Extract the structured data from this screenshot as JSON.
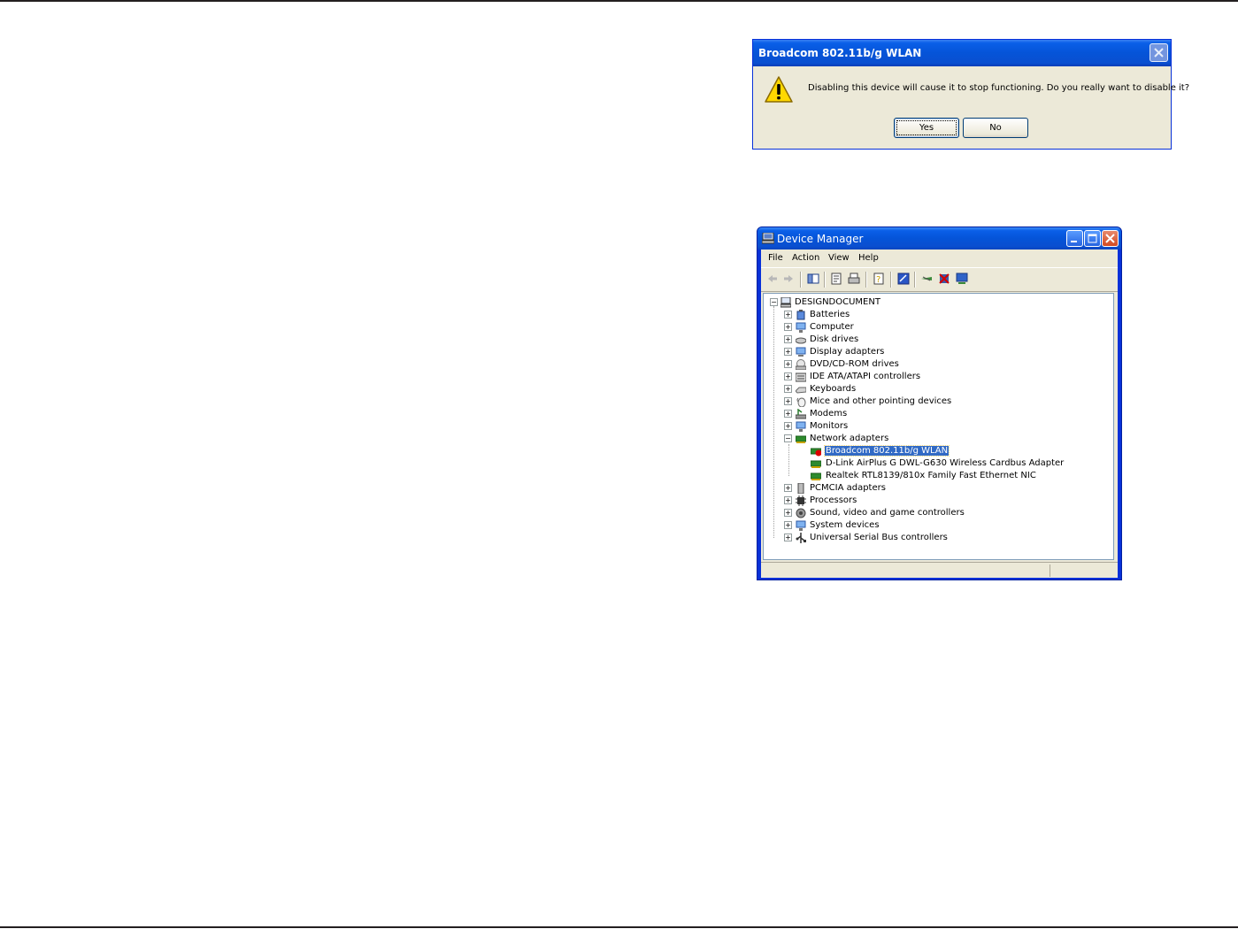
{
  "dialog": {
    "title": "Broadcom 802.11b/g WLAN",
    "message": "Disabling this device will cause it to stop functioning. Do you really want to disable it?",
    "yes_label": "Yes",
    "no_label": "No"
  },
  "device_manager": {
    "title": "Device Manager",
    "menu": [
      "File",
      "Action",
      "View",
      "Help"
    ],
    "tree": {
      "root": "DESIGNDOCUMENT",
      "categories": [
        "Batteries",
        "Computer",
        "Disk drives",
        "Display adapters",
        "DVD/CD-ROM drives",
        "IDE ATA/ATAPI controllers",
        "Keyboards",
        "Mice and other pointing devices",
        "Modems",
        "Monitors",
        "Network adapters",
        "PCMCIA adapters",
        "Processors",
        "Sound, video and game controllers",
        "System devices",
        "Universal Serial Bus controllers"
      ],
      "network_adapters": [
        "Broadcom 802.11b/g WLAN",
        "D-Link AirPlus G DWL-G630 Wireless Cardbus Adapter",
        "Realtek RTL8139/810x Family Fast Ethernet NIC"
      ],
      "selected": "Broadcom 802.11b/g WLAN"
    }
  },
  "colors": {
    "titlebar_blue": "#0554d8",
    "window_face": "#ece9d8",
    "selection": "#316ac5"
  }
}
